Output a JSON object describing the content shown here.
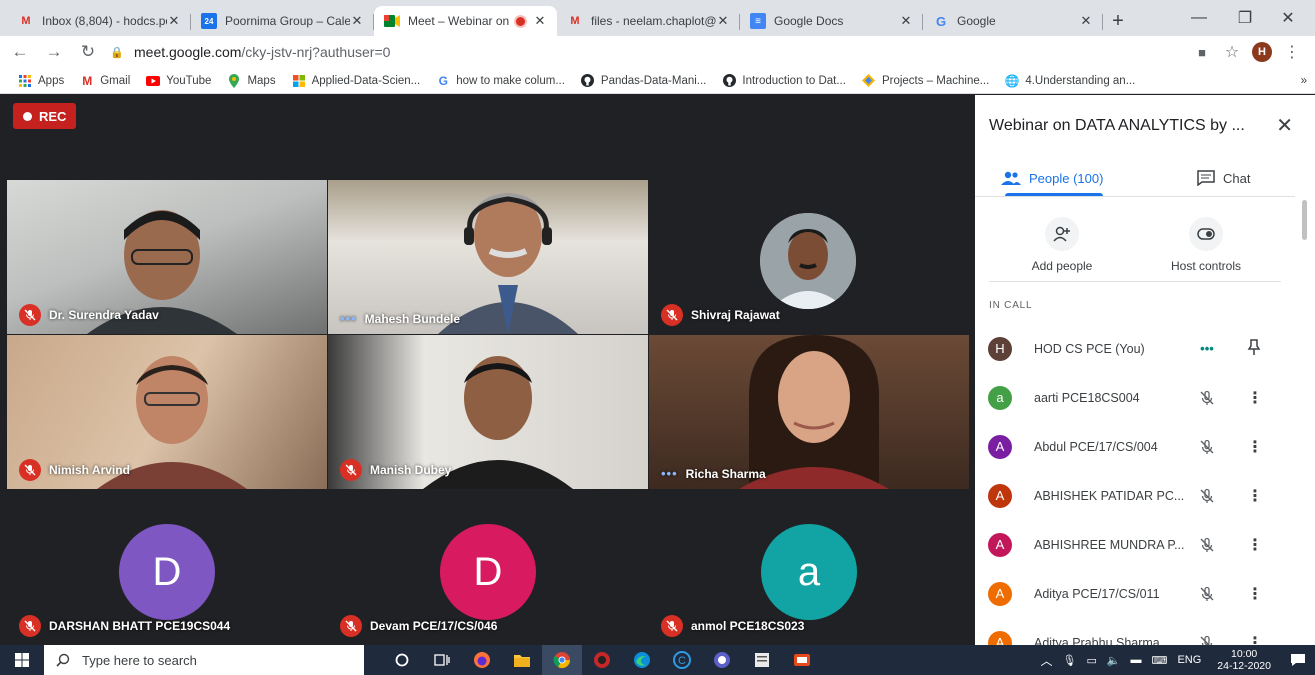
{
  "browser": {
    "tabs": [
      {
        "title": "Inbox (8,804) - hodcs.po",
        "icon": "gmail-icon",
        "active": false
      },
      {
        "title": "Poornima Group – Cale",
        "icon": "calendar-icon",
        "active": false
      },
      {
        "title": "Meet – Webinar on",
        "icon": "meet-icon",
        "active": true
      },
      {
        "title": "files - neelam.chaplot@",
        "icon": "gmail-icon",
        "active": false
      },
      {
        "title": "Google Docs",
        "icon": "docs-icon",
        "active": false
      },
      {
        "title": "Google",
        "icon": "google-icon",
        "active": false
      }
    ],
    "url_host": "meet.google.com",
    "url_path": "/cky-jstv-nrj?authuser=0",
    "profile_initial": "H",
    "bookmarks": [
      {
        "label": "Apps",
        "icon": "apps-grid-icon"
      },
      {
        "label": "Gmail",
        "icon": "gmail-icon"
      },
      {
        "label": "YouTube",
        "icon": "youtube-icon"
      },
      {
        "label": "Maps",
        "icon": "maps-pin-icon"
      },
      {
        "label": "Applied-Data-Scien...",
        "icon": "windows-logo-icon"
      },
      {
        "label": "how to make colum...",
        "icon": "google-icon"
      },
      {
        "label": "Pandas-Data-Mani...",
        "icon": "github-icon"
      },
      {
        "label": "Introduction to Dat...",
        "icon": "github-icon"
      },
      {
        "label": "Projects – Machine...",
        "icon": "diamond-icon"
      },
      {
        "label": "4.Understanding an...",
        "icon": "globe-icon"
      }
    ]
  },
  "meet": {
    "rec_label": "REC",
    "participants": [
      {
        "name": "Dr. Surendra Yadav",
        "state": "muted"
      },
      {
        "name": "Mahesh Bundele",
        "state": "speaking"
      },
      {
        "name": "Shivraj Rajawat",
        "state": "muted"
      },
      {
        "name": "Nimish Arvind",
        "state": "muted"
      },
      {
        "name": "Manish Dubey",
        "state": "muted"
      },
      {
        "name": "Richa Sharma",
        "state": "speaking"
      },
      {
        "name": "DARSHAN BHATT PCE19CS044",
        "state": "muted",
        "initial": "D",
        "color": "#7e57c2"
      },
      {
        "name": "Devam PCE/17/CS/046",
        "state": "muted",
        "initial": "D",
        "color": "#d81b60"
      },
      {
        "name": "anmol PCE18CS023",
        "state": "muted",
        "initial": "a",
        "color": "#12a4a4"
      }
    ]
  },
  "panel": {
    "title": "Webinar on DATA ANALYTICS by ...",
    "people_tab": "People (100)",
    "chat_tab": "Chat",
    "add_people": "Add people",
    "host_controls": "Host controls",
    "in_call": "IN CALL",
    "people": [
      {
        "name": "HOD CS PCE (You)",
        "initial": "H",
        "color": "#5d4037",
        "state": "speaking"
      },
      {
        "name": "aarti PCE18CS004",
        "initial": "a",
        "color": "#43a047",
        "state": "muted"
      },
      {
        "name": "Abdul PCE/17/CS/004",
        "initial": "A",
        "color": "#7b1fa2",
        "state": "muted"
      },
      {
        "name": "ABHISHEK PATIDAR PC...",
        "initial": "A",
        "color": "#bf360c",
        "state": "muted"
      },
      {
        "name": "ABHISHREE MUNDRA P...",
        "initial": "A",
        "color": "#c2185b",
        "state": "muted"
      },
      {
        "name": "Aditya PCE/17/CS/011",
        "initial": "A",
        "color": "#ef6c00",
        "state": "muted"
      },
      {
        "name": "Aditya Prabhu Sharma",
        "initial": "A",
        "color": "#ef6c00",
        "state": "muted"
      }
    ]
  },
  "taskbar": {
    "search_placeholder": "Type here to search",
    "lang": "ENG",
    "time": "10:00",
    "date": "24-12-2020"
  }
}
